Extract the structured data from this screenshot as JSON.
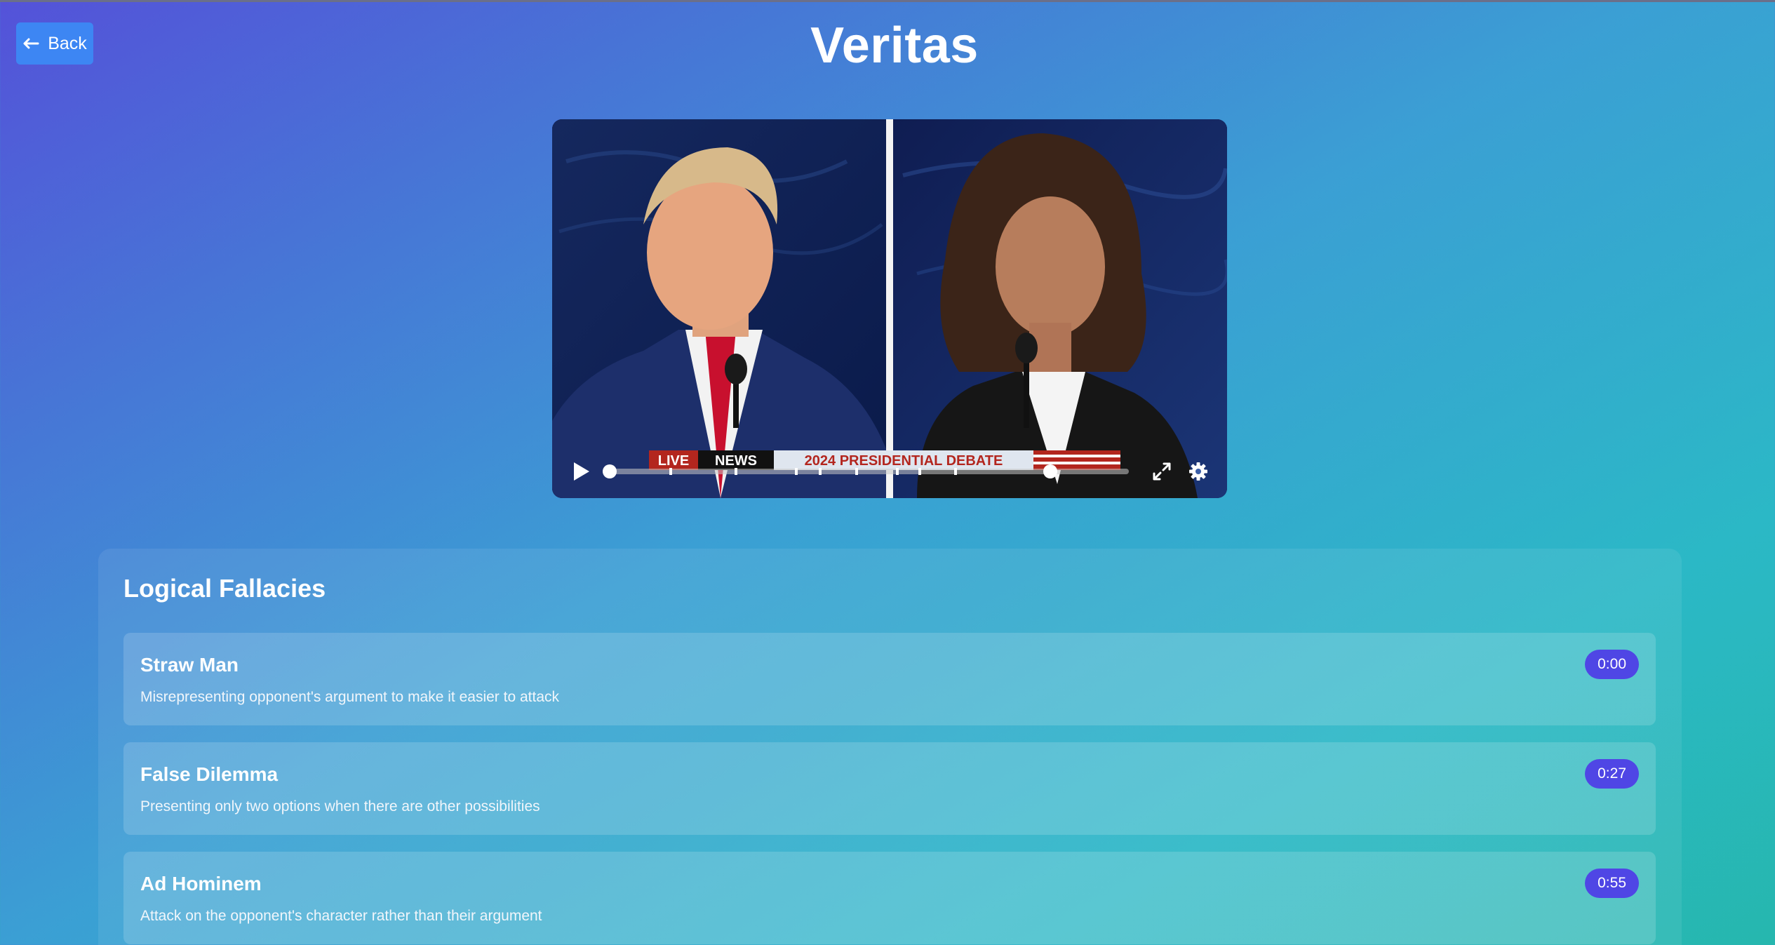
{
  "header": {
    "back_label": "Back",
    "title": "Veritas"
  },
  "video": {
    "overlay_text": {
      "live": "LIVE",
      "network": "NEWS",
      "banner": "2024 PRESIDENTIAL DEBATE"
    },
    "progress": 0
  },
  "fallacies": {
    "section_title": "Logical Fallacies",
    "items": [
      {
        "name": "Straw Man",
        "description": "Misrepresenting opponent's argument to make it easier to attack",
        "timestamp": "0:00"
      },
      {
        "name": "False Dilemma",
        "description": "Presenting only two options when there are other possibilities",
        "timestamp": "0:27"
      },
      {
        "name": "Ad Hominem",
        "description": "Attack on the opponent's character rather than their argument",
        "timestamp": "0:55"
      }
    ]
  },
  "colors": {
    "accent": "#4f46e5",
    "back_button": "#3d86f3"
  },
  "icons": [
    "arrow-left-icon",
    "play-icon",
    "fullscreen-icon",
    "gear-icon"
  ]
}
